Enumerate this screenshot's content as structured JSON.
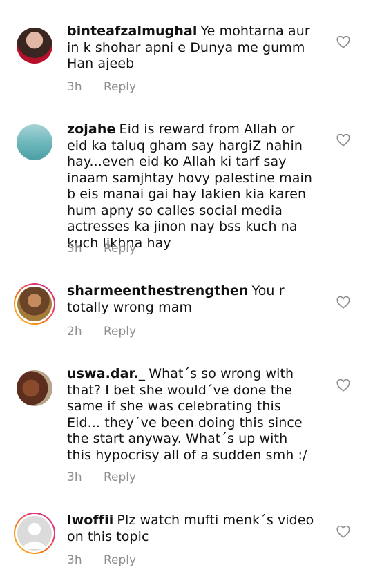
{
  "comments": [
    {
      "username": "binteafzalmughal",
      "text": "Ye mohtarna aur in k shohar apni e Dunya me gumm Han ajeeb",
      "time": "3h",
      "reply_label": "Reply",
      "avatar_icon": "profile-photo",
      "story_ring": false
    },
    {
      "username": "zojahe",
      "text": "Eid is reward from Allah or eid ka taluq gham say hargiZ nahin hay...even eid ko Allah ki tarf say inaam samjhtay hovy palestine main b eis manai gai hay lakien kia karen hum apny so calles social media actresses ka jinon nay bss kuch na kuch likhna hay",
      "time": "3h",
      "reply_label": "Reply",
      "avatar_icon": "profile-photo",
      "story_ring": false
    },
    {
      "username": "sharmeenthestrengthen",
      "text": "You r totally wrong mam",
      "time": "2h",
      "reply_label": "Reply",
      "avatar_icon": "profile-photo",
      "story_ring": true
    },
    {
      "username": "uswa.dar._",
      "text": "What´s so wrong with that? I bet she would´ve done the same if she was celebrating this Eid... they´ve been doing this since the start anyway. What´s up with this hypocrisy all of a sudden smh :/",
      "time": "3h",
      "reply_label": "Reply",
      "avatar_icon": "profile-photo",
      "story_ring": false
    },
    {
      "username": "lwoffii",
      "text": "Plz watch mufti menk´s video on this topic",
      "time": "3h",
      "reply_label": "Reply",
      "avatar_icon": "default-avatar",
      "story_ring": true
    }
  ],
  "colors": {
    "meta_text": "#8e8e8e",
    "text": "#111111",
    "ring_gradient": [
      "#f9c74f",
      "#f77f00",
      "#e63970",
      "#c13584"
    ]
  },
  "icons": {
    "like": "heart-outline-icon"
  }
}
